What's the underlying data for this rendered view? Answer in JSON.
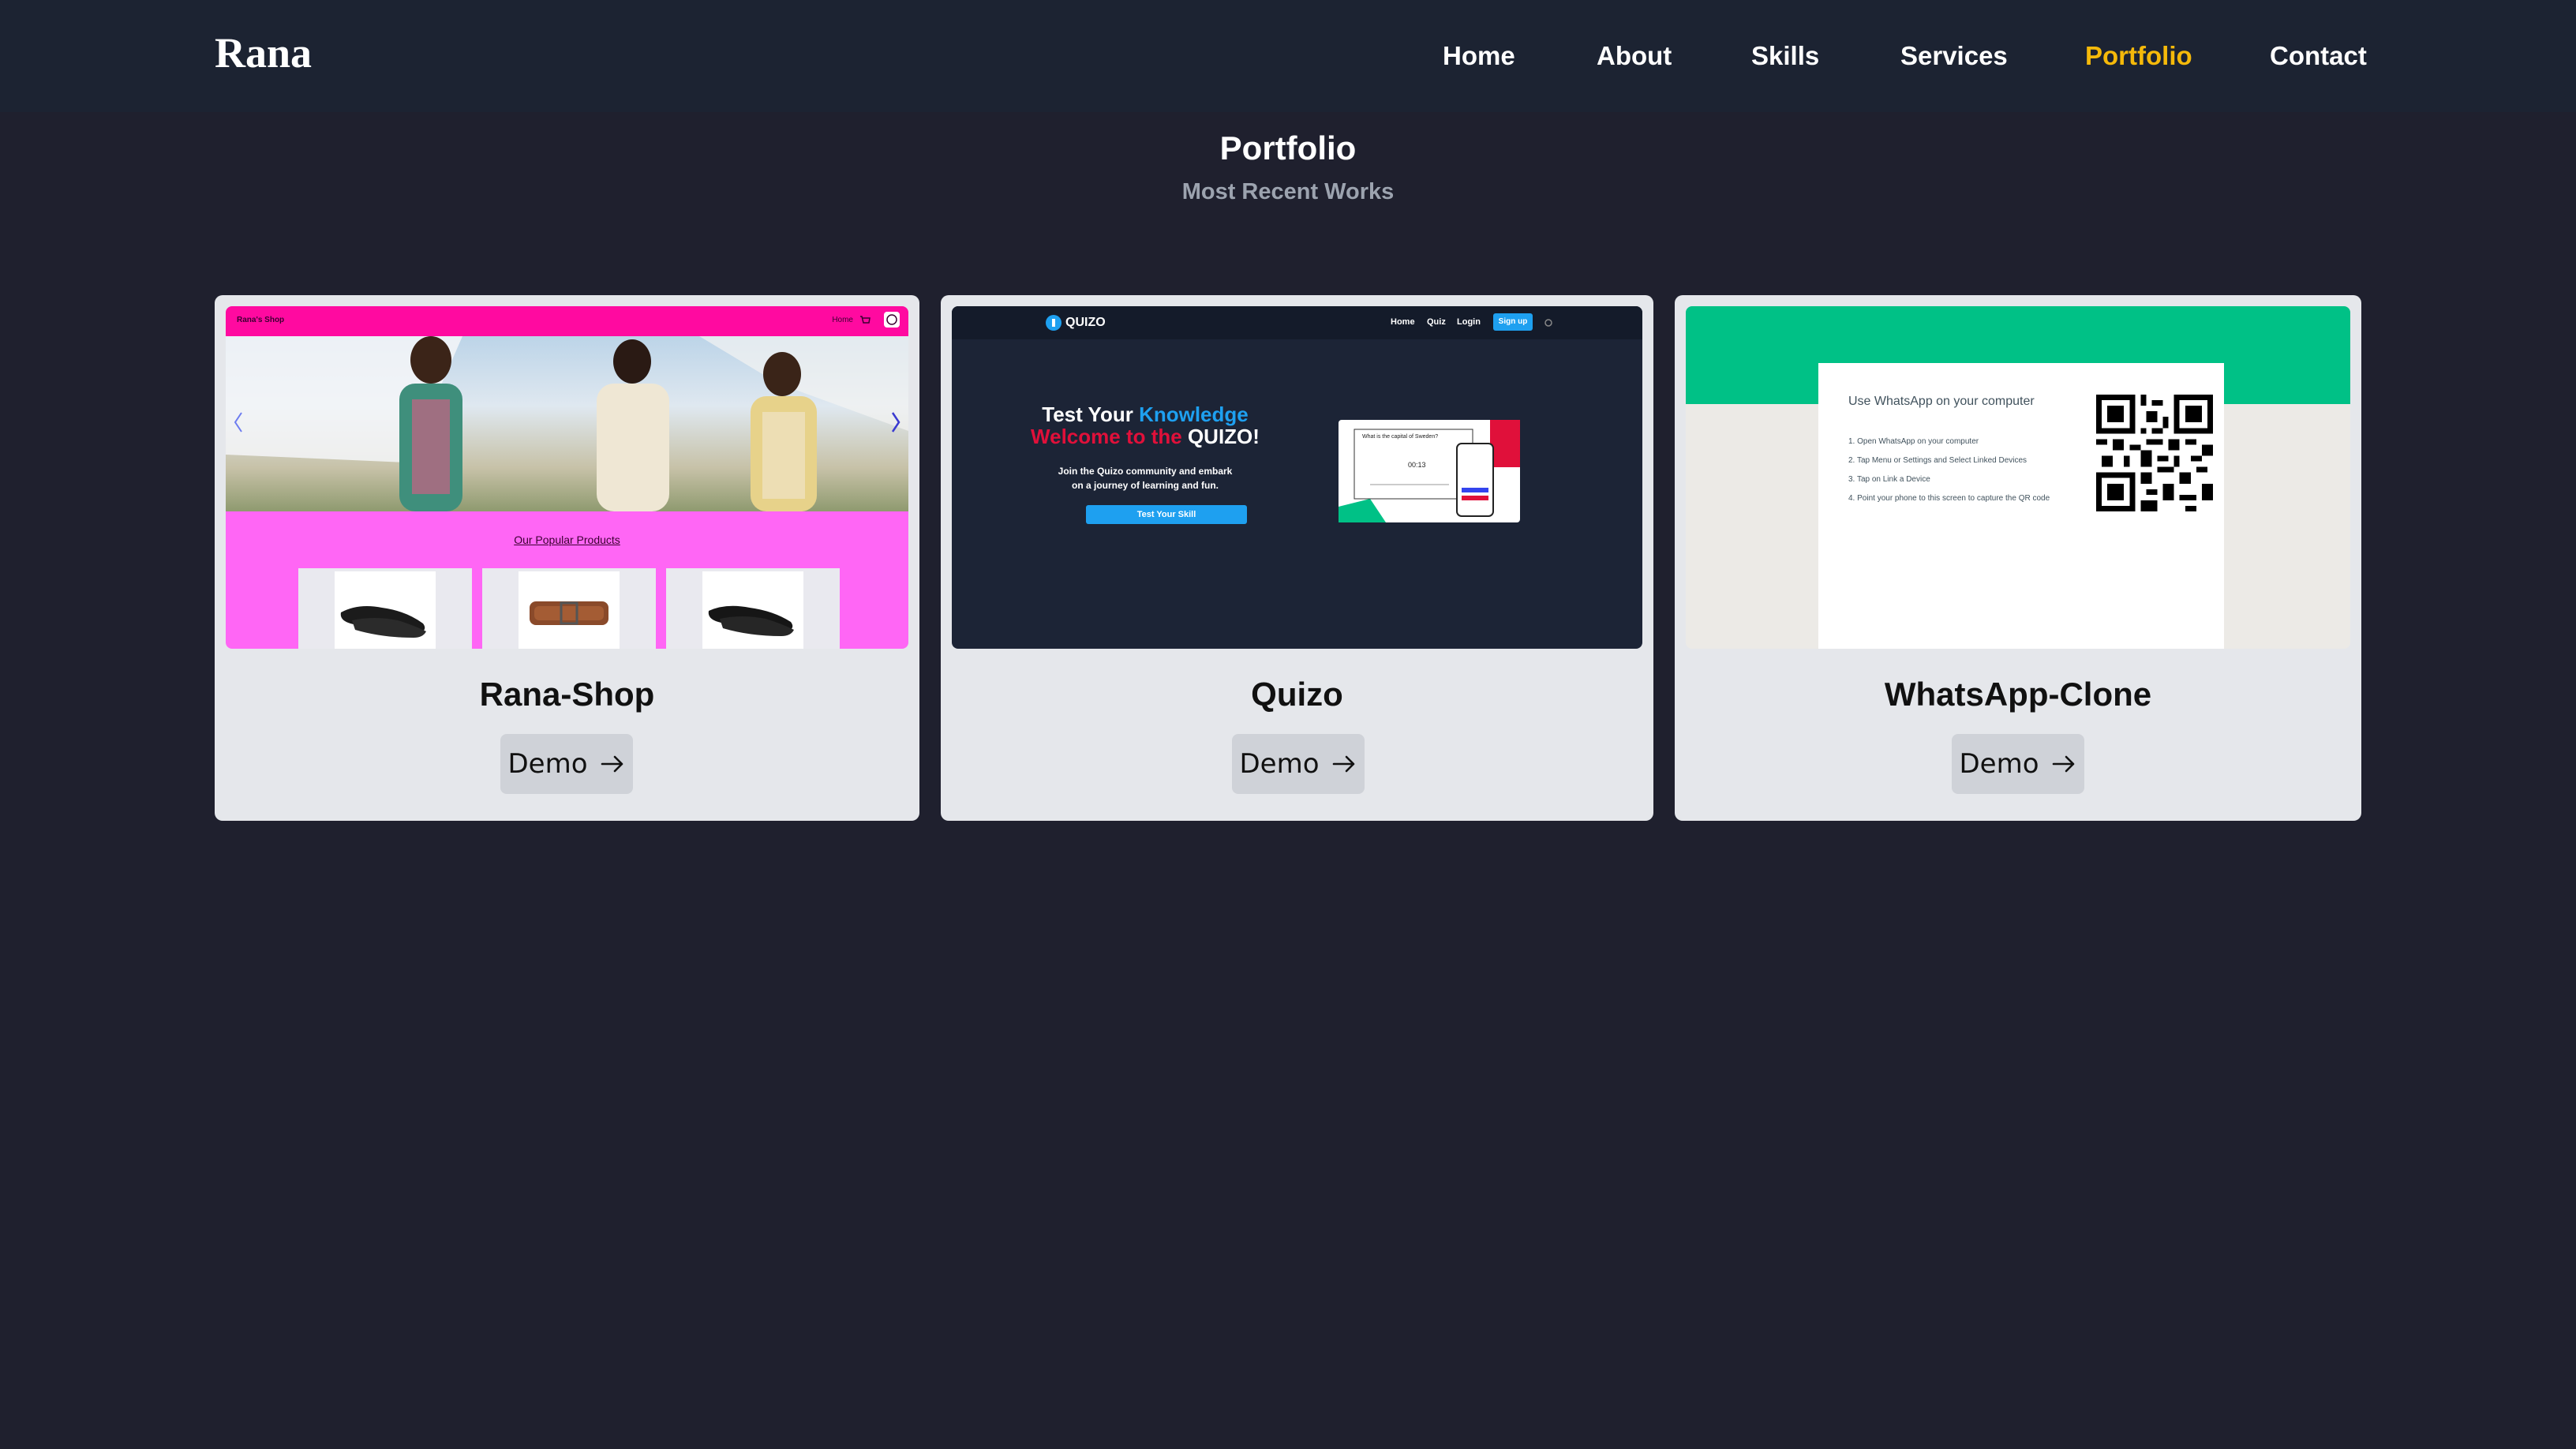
{
  "brand": "Rana",
  "nav": {
    "items": [
      {
        "label": "Home",
        "active": false
      },
      {
        "label": "About",
        "active": false
      },
      {
        "label": "Skills",
        "active": false
      },
      {
        "label": "Services",
        "active": false
      },
      {
        "label": "Portfolio",
        "active": true
      },
      {
        "label": "Contact",
        "active": false
      }
    ],
    "active_color": "#f5b90a"
  },
  "section": {
    "title": "Portfolio",
    "subtitle": "Most Recent Works"
  },
  "projects": [
    {
      "title": "Rana-Shop",
      "button_label": "Demo",
      "button_icon": "arrow-right-icon",
      "preview": {
        "brand": "Rana's Shop",
        "nav_home": "Home",
        "popular_heading": "Our Popular Products",
        "accent": "#ff0aa0"
      }
    },
    {
      "title": "Quizo",
      "button_label": "Demo",
      "button_icon": "arrow-right-icon",
      "preview": {
        "logo": "QUIZO",
        "nav": [
          "Home",
          "Quiz",
          "Login"
        ],
        "signup": "Sign up",
        "headline_1a": "Test Your ",
        "headline_1b": "Knowledge",
        "headline_2a": "Welcome to the ",
        "headline_2b": "QUIZO!",
        "body_1": "Join the Quizo community and embark",
        "body_2": "on a journey of learning and fun.",
        "cta": "Test Your Skill",
        "question": "What is the capital of Sweden?",
        "timer": "00:13"
      }
    },
    {
      "title": "WhatsApp-Clone",
      "button_label": "Demo",
      "button_icon": "arrow-right-icon",
      "preview": {
        "heading": "Use WhatsApp on your computer",
        "steps": [
          "1. Open WhatsApp on your computer",
          "2. Tap Menu or Settings and Select Linked Devices",
          "3. Tap on Link a Device",
          "4. Point your phone to this screen to capture the QR code"
        ],
        "accent": "#00c186"
      }
    }
  ]
}
